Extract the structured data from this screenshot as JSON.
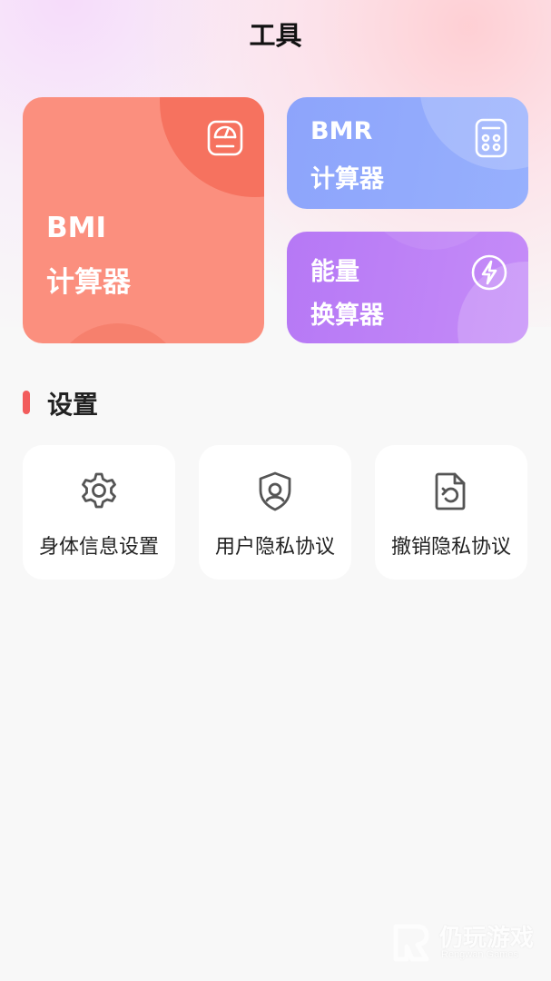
{
  "header": {
    "title": "工具"
  },
  "cards": {
    "bmi": {
      "line1": "BMI",
      "line2": "计算器",
      "icon": "scale-icon"
    },
    "bmr": {
      "line1": "BMR",
      "line2": "计算器",
      "icon": "calculator-icon"
    },
    "energy": {
      "line1": "能量",
      "line2": "换算器",
      "icon": "lightning-icon"
    }
  },
  "settings": {
    "title": "设置",
    "items": [
      {
        "label": "身体信息设置",
        "icon": "gear-icon"
      },
      {
        "label": "用户隐私协议",
        "icon": "shield-icon"
      },
      {
        "label": "撤销隐私协议",
        "icon": "revoke-document-icon"
      }
    ]
  },
  "watermark": {
    "title": "仍玩游戏",
    "subtitle": "Rengwan Games"
  },
  "colors": {
    "bmi_card": "#fb8f7e",
    "bmr_card": "#8da4fb",
    "energy_card": "#b678f5",
    "section_accent": "#f25c5c",
    "background": "#f8f8f8"
  }
}
